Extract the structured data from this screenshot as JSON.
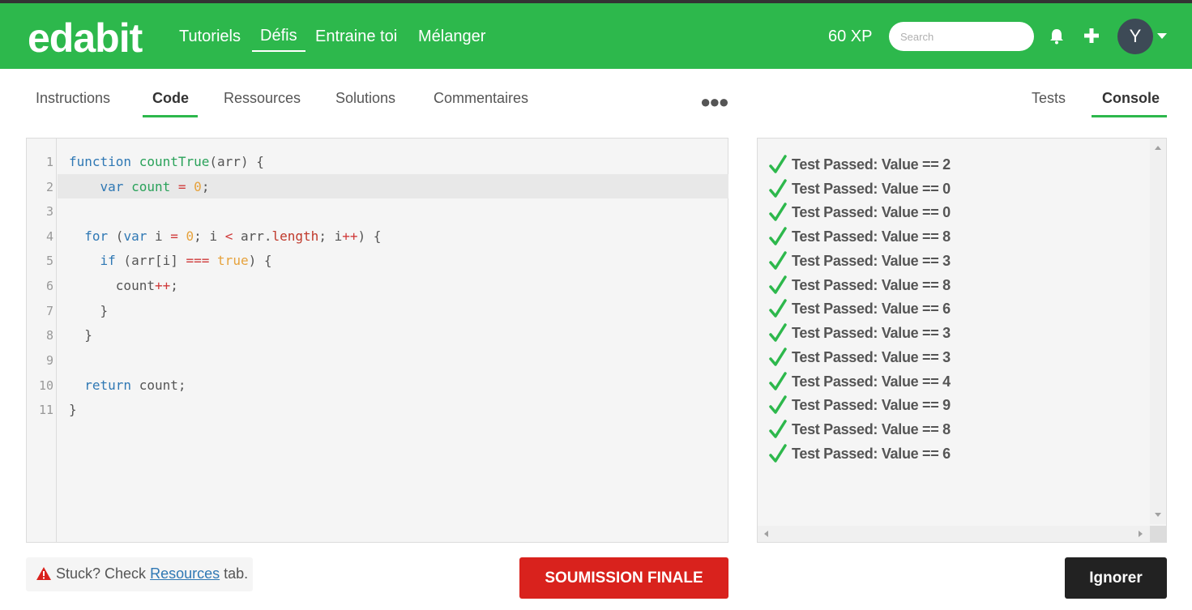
{
  "brand": {
    "name": "edabit",
    "accent": "#2db84c"
  },
  "nav": {
    "links": [
      "Tutoriels",
      "Défis",
      "Entraine toi",
      "Mélanger"
    ],
    "active": "Défis",
    "xp": "60 XP",
    "search_placeholder": "Search",
    "avatar_initial": "Y"
  },
  "tabs": {
    "left": [
      "Instructions",
      "Code",
      "Ressources",
      "Solutions",
      "Commentaires"
    ],
    "left_active": "Code",
    "right": [
      "Tests",
      "Console"
    ],
    "right_active": "Console"
  },
  "editor": {
    "line_numbers": [
      "1",
      "2",
      "3",
      "4",
      "5",
      "6",
      "7",
      "8",
      "9",
      "10",
      "11"
    ],
    "current_line": 2,
    "lines": [
      "function countTrue(arr) {",
      "    var count = 0;",
      "",
      "  for (var i = 0; i < arr.length; i++) {",
      "    if (arr[i] === true) {",
      "      count++;",
      "    }",
      "  }",
      "",
      "  return count;",
      "}"
    ]
  },
  "console": {
    "results": [
      "Test Passed: Value == 2",
      "Test Passed: Value == 0",
      "Test Passed: Value == 0",
      "Test Passed: Value == 8",
      "Test Passed: Value == 3",
      "Test Passed: Value == 8",
      "Test Passed: Value == 6",
      "Test Passed: Value == 3",
      "Test Passed: Value == 3",
      "Test Passed: Value == 4",
      "Test Passed: Value == 9",
      "Test Passed: Value == 8",
      "Test Passed: Value == 6"
    ]
  },
  "footer": {
    "stuck_prefix": "Stuck? Check",
    "stuck_link": "Resources",
    "stuck_suffix": "tab.",
    "submit_label": "SOUMISSION FINALE",
    "ignore_label": "Ignorer",
    "submit_color": "#d9221d",
    "ignore_color": "#222222"
  }
}
